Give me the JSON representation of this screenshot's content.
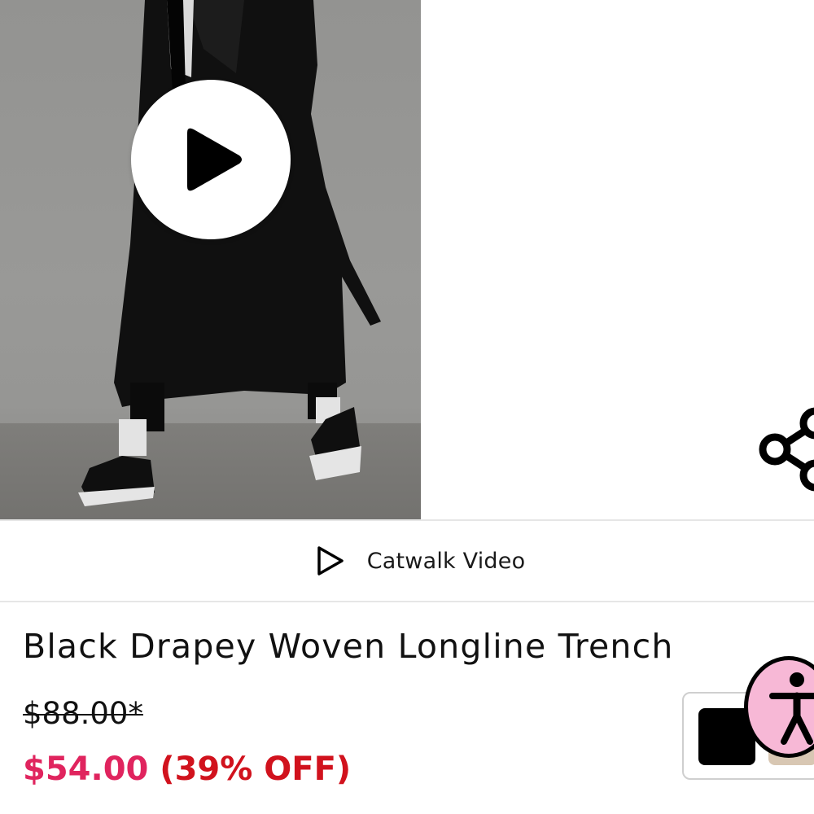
{
  "product": {
    "title": "Black Drapey Woven Longline Trench",
    "old_price": "$88.00*",
    "sale_price": "$54.00",
    "discount": "(39% OFF)"
  },
  "media": {
    "catwalk_label": "Catwalk Video",
    "play_icon": "play-icon",
    "share_icon": "share-icon"
  },
  "widgets": {
    "accessibility_icon": "accessibility-icon",
    "swatch_color": "#000000"
  },
  "colors": {
    "sale_price": "#e0245e",
    "discount": "#d1121d",
    "accessibility_bg": "#f7b8d6"
  }
}
